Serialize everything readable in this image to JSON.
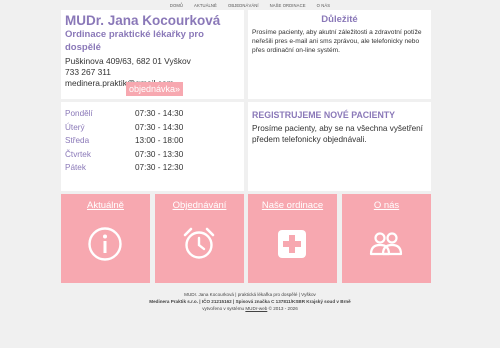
{
  "nav": {
    "items": [
      "Domů",
      "Aktuálně",
      "Objednávání",
      "Naše ordinace",
      "O nás"
    ]
  },
  "contact": {
    "name": "MUDr. Jana Kocourková",
    "subtitle": "Ordinace praktické lékařky pro dospělé",
    "address": "Puškinova 409/63, 682 01 Vyškov",
    "phone": "733 267 311",
    "email": "medinera.praktik@gmail.com",
    "order_button": "objednávka»"
  },
  "important": {
    "heading": "Důležité",
    "text": "Prosíme pacienty, aby akutní záležitosti a zdravotní potíže neřešili pres e-mail ani sms zprávou, ale telefonicky nebo přes ordinační on-line systém."
  },
  "hours": [
    {
      "day": "Pondělí",
      "time": "07:30 - 14:30"
    },
    {
      "day": "Úterý",
      "time": "07:30 - 14:30"
    },
    {
      "day": "Středa",
      "time": "13:00 - 18:00"
    },
    {
      "day": "Čtvrtek",
      "time": "07:30 - 13:30"
    },
    {
      "day": "Pátek",
      "time": "07:30 - 12:30"
    }
  ],
  "registration": {
    "heading": "REGISTRUJEME NOVÉ PACIENTY",
    "text": "Prosíme pacienty, aby se na všechna vyšetření předem telefonicky objednávali."
  },
  "tiles": [
    {
      "label": "Aktuálně",
      "icon": "info-icon"
    },
    {
      "label": "Objednávání",
      "icon": "alarm-clock-icon"
    },
    {
      "label": "Naše ordinace",
      "icon": "medical-cross-icon"
    },
    {
      "label": "O nás",
      "icon": "people-icon"
    }
  ],
  "footer": {
    "line1": "MUDr. Jana Kocourková | praktická lékařka pro dospělé | Vyškov",
    "line2": "Medinera Praktik s.r.o. | IČO 21215162 | Spisová značka C 137811/KSBR Krajský soud v Brně",
    "line3_prefix": "vytvořeno v systému",
    "line3_link": "MUDr-web",
    "line3_suffix": "© 2013 - 2026"
  },
  "colors": {
    "accent_purple": "#8a78b8",
    "tile_pink": "#f7a8b0",
    "background": "#f0f0f0"
  }
}
